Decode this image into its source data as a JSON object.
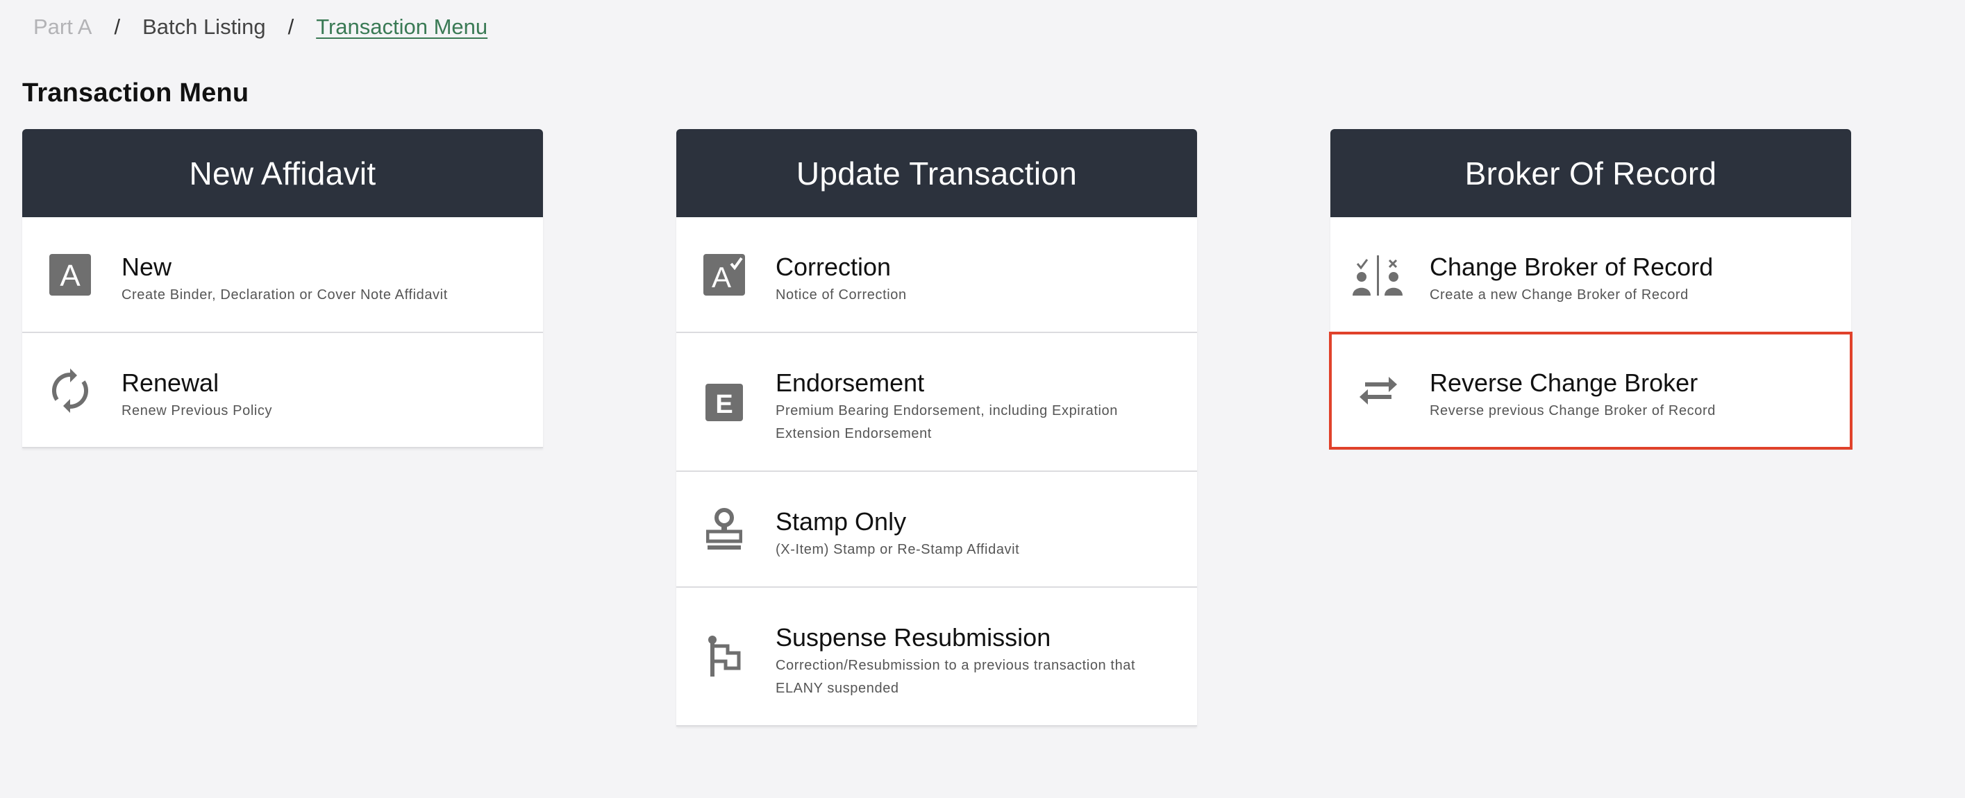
{
  "breadcrumb": {
    "items": [
      "Part A",
      "Batch Listing",
      "Transaction Menu"
    ],
    "separator": "/"
  },
  "page_title": "Transaction Menu",
  "cards": [
    {
      "title": "New Affidavit",
      "items": [
        {
          "label": "New",
          "description": "Create Binder, Declaration or Cover Note Affidavit",
          "icon": "letter-a-icon"
        },
        {
          "label": "Renewal",
          "description": "Renew Previous Policy",
          "icon": "refresh-icon"
        }
      ]
    },
    {
      "title": "Update Transaction",
      "items": [
        {
          "label": "Correction",
          "description": "Notice of Correction",
          "icon": "letter-a-check-icon"
        },
        {
          "label": "Endorsement",
          "description": "Premium Bearing Endorsement, including Expiration Extension Endorsement",
          "icon": "letter-e-icon"
        },
        {
          "label": "Stamp Only",
          "description": "(X-Item) Stamp or Re-Stamp Affidavit",
          "icon": "stamp-icon"
        },
        {
          "label": "Suspense Resubmission",
          "description": "Correction/Resubmission to a previous transaction that ELANY suspended",
          "icon": "flag-icon"
        }
      ]
    },
    {
      "title": "Broker Of Record",
      "items": [
        {
          "label": "Change Broker of Record",
          "description": "Create a new Change Broker of Record",
          "icon": "person-swap-icon"
        },
        {
          "label": "Reverse Change Broker",
          "description": "Reverse previous Change Broker of Record",
          "icon": "swap-arrows-icon",
          "highlighted": true
        }
      ]
    }
  ],
  "colors": {
    "header_bg": "#2c323d",
    "page_bg": "#f4f4f6",
    "icon_gray": "#6f6f6f",
    "highlight_border": "#e0422b",
    "breadcrumb_active": "#3a7a55"
  }
}
